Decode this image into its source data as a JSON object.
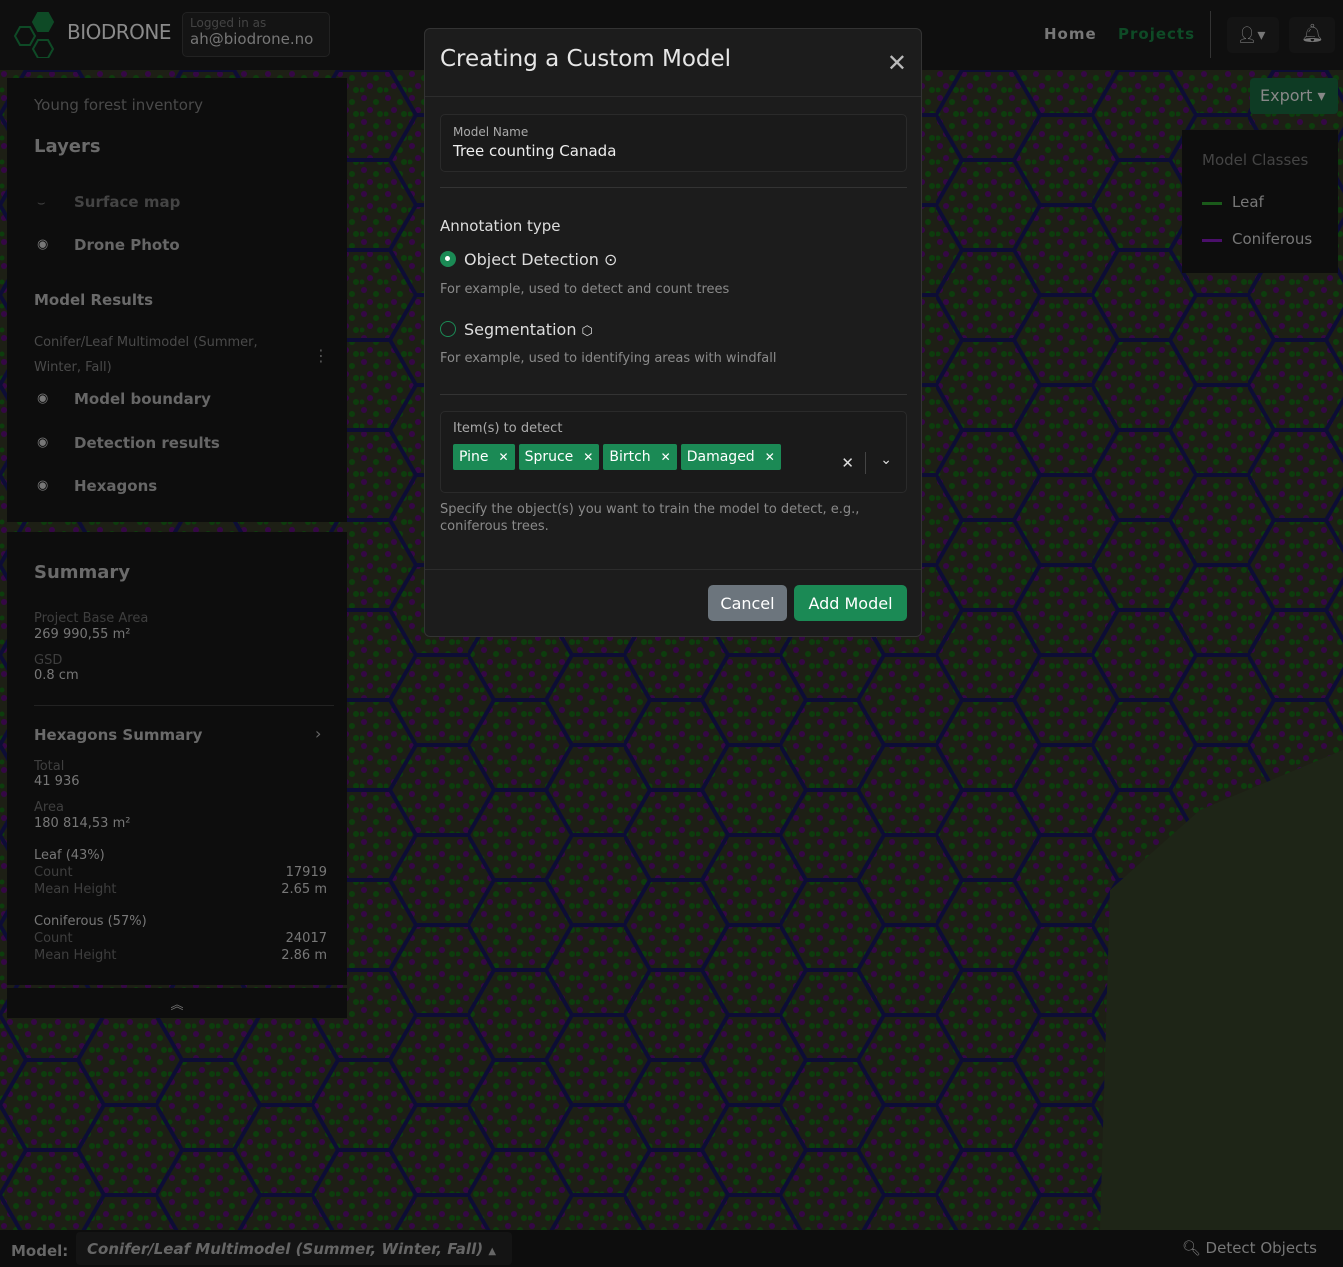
{
  "header": {
    "brand": "BIODRONE",
    "logged_in_label": "Logged in as",
    "user_email": "ah@biodrone.no",
    "nav": [
      {
        "label": "Home"
      },
      {
        "label": "Projects"
      }
    ]
  },
  "sidebar": {
    "project": "Young forest inventory",
    "layers_title": "Layers",
    "layers": [
      {
        "label": "Surface map",
        "icon": "surface-icon"
      },
      {
        "label": "Drone Photo",
        "icon": "eye-icon"
      }
    ],
    "model_results_title": "Model Results",
    "model_name": "Conifer/Leaf Multimodel (Summer, Winter, Fall)",
    "results": [
      {
        "label": "Model boundary"
      },
      {
        "label": "Detection results"
      },
      {
        "label": "Hexagons"
      }
    ]
  },
  "summary": {
    "title": "Summary",
    "base_area_label": "Project Base Area",
    "base_area": "269 990,55 m²",
    "gsd_label": "GSD",
    "gsd": "0.8 cm",
    "hex_title": "Hexagons Summary",
    "total_label": "Total",
    "total": "41 936",
    "area_label": "Area",
    "area": "180 814,53 m²",
    "classes": [
      {
        "title": "Leaf (43%)",
        "count_label": "Count",
        "count": "17919",
        "height_label": "Mean Height",
        "height": "2.65 m"
      },
      {
        "title": "Coniferous (57%)",
        "count_label": "Count",
        "count": "24017",
        "height_label": "Mean Height",
        "height": "2.86 m"
      }
    ]
  },
  "export_label": "Export",
  "legend": {
    "title": "Model Classes",
    "items": [
      {
        "label": "Leaf",
        "color": "#1a7a1a"
      },
      {
        "label": "Coniferous",
        "color": "#6a0f8a"
      }
    ]
  },
  "bottom": {
    "model_label": "Model:",
    "model_value": "Conifer/Leaf Multimodel (Summer, Winter, Fall)",
    "detect_label": "Detect Objects"
  },
  "modal": {
    "title": "Creating a Custom Model",
    "model_name_label": "Model Name",
    "model_name_value": "Tree counting Canada",
    "annotation_label": "Annotation type",
    "options": [
      {
        "label": "Object Detection",
        "help": "For example, used to detect and count trees",
        "selected": true
      },
      {
        "label": "Segmentation",
        "help": "For example, used to identifying areas with windfall",
        "selected": false
      }
    ],
    "items_label": "Item(s) to detect",
    "items": [
      "Pine",
      "Spruce",
      "Birtch",
      "Damaged"
    ],
    "items_help": "Specify the object(s) you want to train the model to detect, e.g., coniferous trees.",
    "cancel": "Cancel",
    "add": "Add Model"
  },
  "colors": {
    "accent": "#1b8a55",
    "hex_line": "#1a1a6a"
  }
}
